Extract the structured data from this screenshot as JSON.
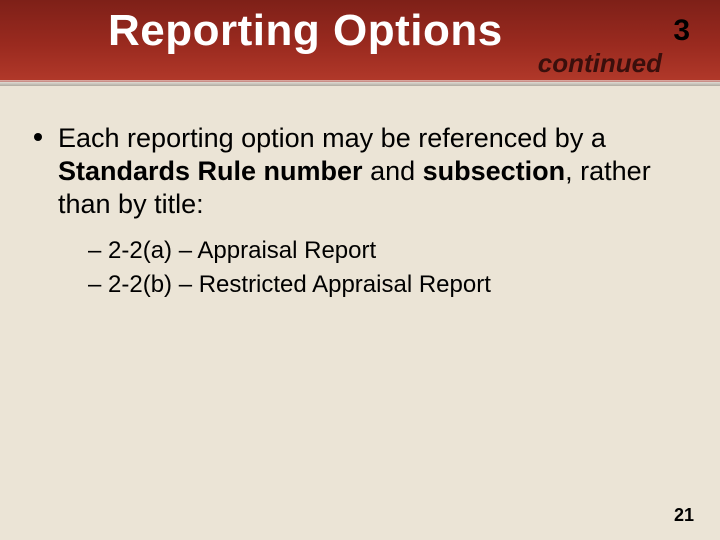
{
  "header": {
    "title": "Reporting Options",
    "section_number": "3",
    "continued_label": "continued"
  },
  "bullet": {
    "lead": "Each reporting option may be referenced by a ",
    "bold1": "Standards Rule number",
    "mid": " and ",
    "bold2": "subsection",
    "tail": ", rather than by title:"
  },
  "subitems": {
    "a": "– 2-2(a) –  Appraisal Report",
    "b": "– 2-2(b) –  Restricted Appraisal Report"
  },
  "page_number": "21"
}
